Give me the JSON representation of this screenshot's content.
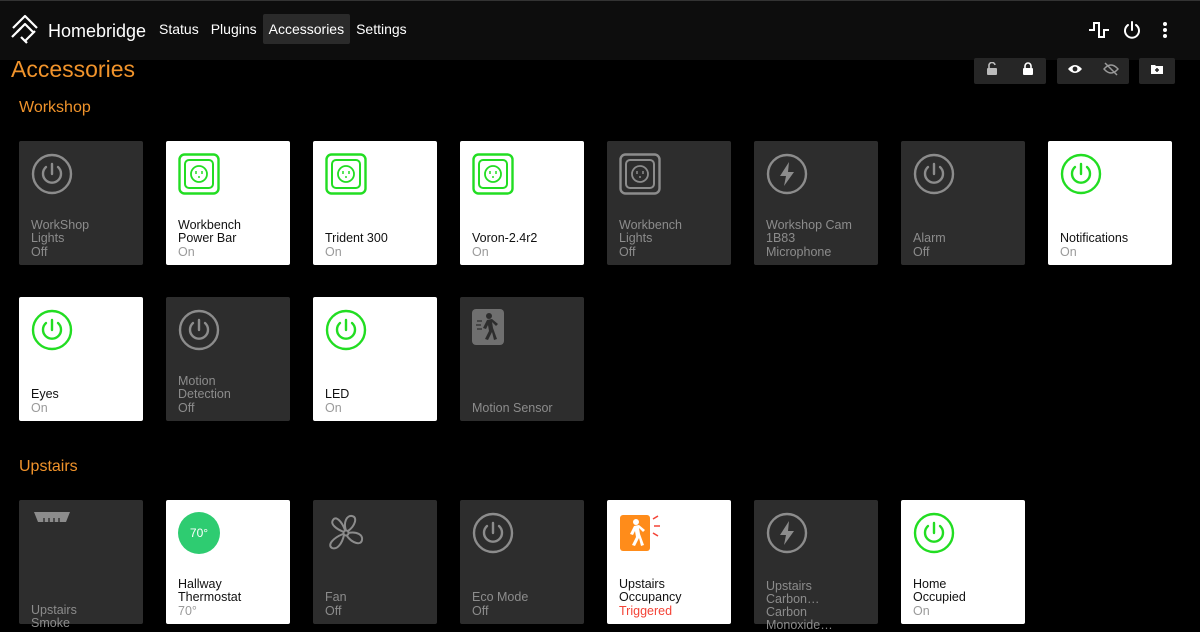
{
  "app": {
    "title": "Homebridge"
  },
  "nav": {
    "items": [
      "Status",
      "Plugins",
      "Accessories",
      "Settings"
    ],
    "active": "Accessories"
  },
  "page": {
    "title": "Accessories"
  },
  "sections": {
    "workshop": "Workshop",
    "upstairs": "Upstairs"
  },
  "tiles": {
    "workshop_lights": {
      "name": "WorkShop\nLights",
      "state": "Off",
      "icon": "power-icon"
    },
    "workbench_power_bar": {
      "name": "Workbench\nPower Bar",
      "state": "On",
      "icon": "outlet-icon"
    },
    "trident_300": {
      "name": "Trident 300",
      "state": "On",
      "icon": "outlet-icon"
    },
    "voron": {
      "name": "Voron-2.4r2",
      "state": "On",
      "icon": "outlet-icon"
    },
    "workbench_lights": {
      "name": "Workbench\nLights",
      "state": "Off",
      "icon": "outlet-icon"
    },
    "workshop_cam": {
      "name": "Workshop Cam\n1B83",
      "state": "Microphone",
      "icon": "bolt-icon"
    },
    "alarm": {
      "name": "Alarm",
      "state": "Off",
      "icon": "power-icon"
    },
    "notifications": {
      "name": "Notifications",
      "state": "On",
      "icon": "power-icon"
    },
    "eyes": {
      "name": "Eyes",
      "state": "On",
      "icon": "power-icon"
    },
    "motion_detection": {
      "name": "Motion\nDetection",
      "state": "Off",
      "icon": "power-icon"
    },
    "led": {
      "name": "LED",
      "state": "On",
      "icon": "power-icon"
    },
    "motion_sensor": {
      "name": "Motion Sensor",
      "icon": "walking-person-icon"
    },
    "upstairs_smoke": {
      "name": "Upstairs\nSmoke",
      "icon": "smoke-detector-icon"
    },
    "hallway_thermostat": {
      "name": "Hallway\nThermostat",
      "state": "70°",
      "current": "70°",
      "icon": "thermostat-icon"
    },
    "fan": {
      "name": "Fan",
      "state": "Off",
      "icon": "fan-icon"
    },
    "eco_mode": {
      "name": "Eco Mode",
      "state": "Off",
      "icon": "power-icon"
    },
    "upstairs_occupancy": {
      "name": "Upstairs\nOccupancy",
      "state": "Triggered",
      "icon": "occupancy-icon"
    },
    "upstairs_carbon": {
      "name": "Upstairs\nCarbon…\nCarbon\nMonoxide…",
      "icon": "bolt-icon"
    },
    "home_occupied": {
      "name": "Home\nOccupied",
      "state": "On",
      "icon": "power-icon"
    }
  },
  "colors": {
    "accent": "#f0932b",
    "on_green": "#22dd22",
    "off_gray": "#8c8c8c",
    "alert": "#f44336",
    "thermostat": "#2ecc71"
  }
}
